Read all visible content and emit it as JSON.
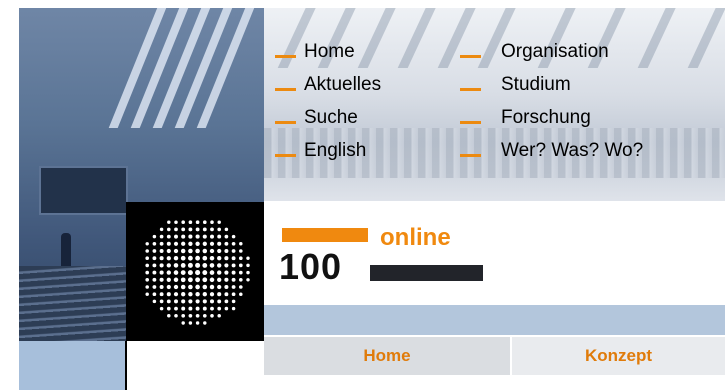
{
  "nav": {
    "left": [
      {
        "label": "Home"
      },
      {
        "label": "Aktuelles"
      },
      {
        "label": "Suche"
      },
      {
        "label": "English"
      }
    ],
    "right": [
      {
        "label": "Organisation"
      },
      {
        "label": "Studium"
      },
      {
        "label": "Forschung"
      },
      {
        "label": "Wer? Was? Wo?"
      }
    ]
  },
  "brand": {
    "number": "100",
    "online": "online"
  },
  "tabs": [
    {
      "label": "Home"
    },
    {
      "label": "Konzept"
    }
  ],
  "colors": {
    "accent": "#f0890f",
    "band": "#b3c6dc",
    "dark": "#22242a"
  }
}
